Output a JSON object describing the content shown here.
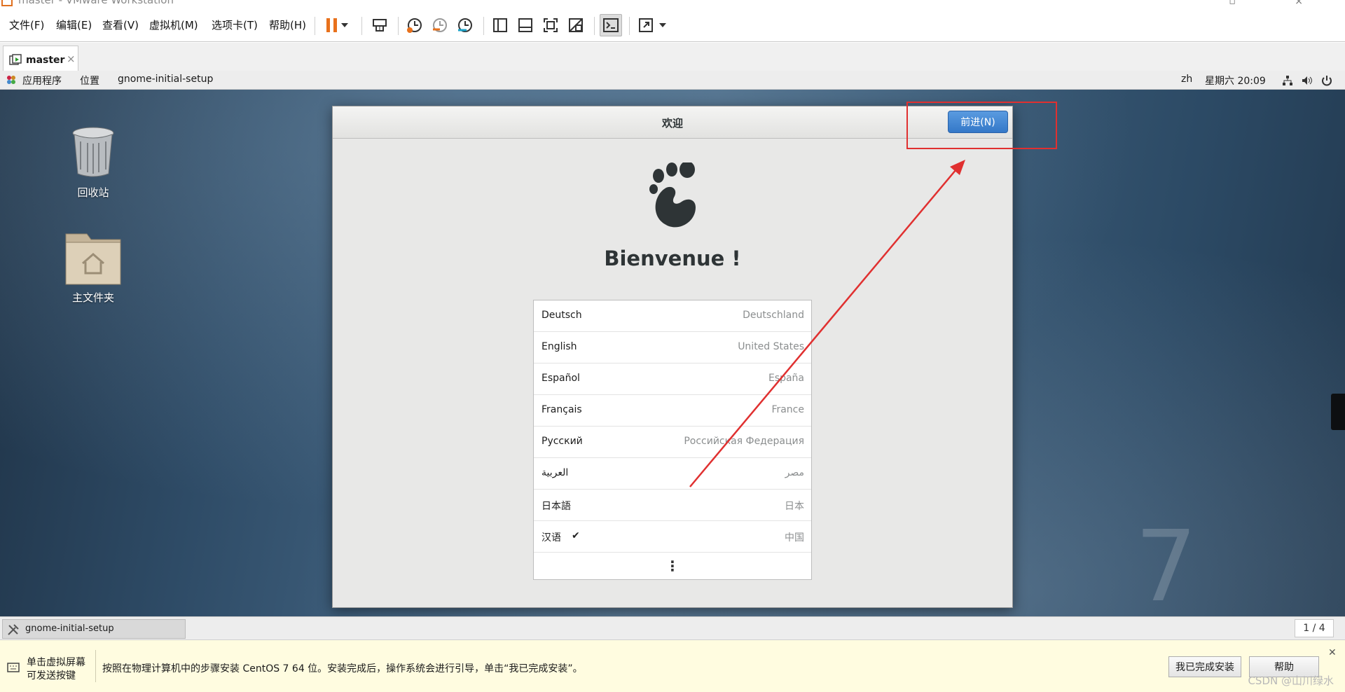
{
  "window": {
    "title": "master - VMware Workstation"
  },
  "menubar": {
    "items": [
      "文件(F)",
      "编辑(E)",
      "查看(V)",
      "虚拟机(M)",
      "选项卡(T)",
      "帮助(H)"
    ]
  },
  "toolbar": {
    "icons": [
      "pause-icon",
      "dropdown-arrow-icon",
      "send-ctrl-alt-del-icon",
      "snapshot-icon",
      "revert-snapshot-icon",
      "snapshot-manager-icon",
      "sidebar-view-icon",
      "thumbnail-view-icon",
      "fit-guest-icon",
      "unity-icon",
      "console-icon",
      "fullscreen-icon"
    ]
  },
  "tabs": [
    {
      "label": "master",
      "close": "×"
    }
  ],
  "gnome_panel": {
    "apps": "应用程序",
    "places": "位置",
    "window": "gnome-initial-setup",
    "input": "zh",
    "clock": "星期六 20:09"
  },
  "desktop_icons": [
    {
      "label": "回收站",
      "icon": "trash-icon"
    },
    {
      "label": "主文件夹",
      "icon": "home-folder-icon"
    }
  ],
  "dialog": {
    "title": "欢迎",
    "next_button": "前进(N)",
    "welcome": "Bienvenue !",
    "languages": [
      {
        "name": "Deutsch",
        "country": "Deutschland",
        "selected": false
      },
      {
        "name": "English",
        "country": "United States",
        "selected": false
      },
      {
        "name": "Español",
        "country": "España",
        "selected": false
      },
      {
        "name": "Français",
        "country": "France",
        "selected": false
      },
      {
        "name": "Русский",
        "country": "Российская Федерация",
        "selected": false
      },
      {
        "name": "العربية",
        "country": "مصر",
        "selected": false
      },
      {
        "name": "日本語",
        "country": "日本",
        "selected": false
      },
      {
        "name": "汉语",
        "country": "中国",
        "selected": true
      }
    ],
    "more": "⋮",
    "check": "✔"
  },
  "taskbar": {
    "item": "gnome-initial-setup",
    "pager": "1 / 4"
  },
  "infobar": {
    "hint_line1": "单击虚拟屏幕",
    "hint_line2": "可发送按键",
    "message": "按照在物理计算机中的步骤安装 CentOS 7 64 位。安装完成后，操作系统会进行引导，单击“我已完成安装”。",
    "done_button": "我已完成安装",
    "help_button": "帮助"
  },
  "watermark": "CSDN @山川绿水",
  "desktop_mark": "7",
  "colors": {
    "accent": "#3478c8",
    "annotation": "#e03030"
  }
}
